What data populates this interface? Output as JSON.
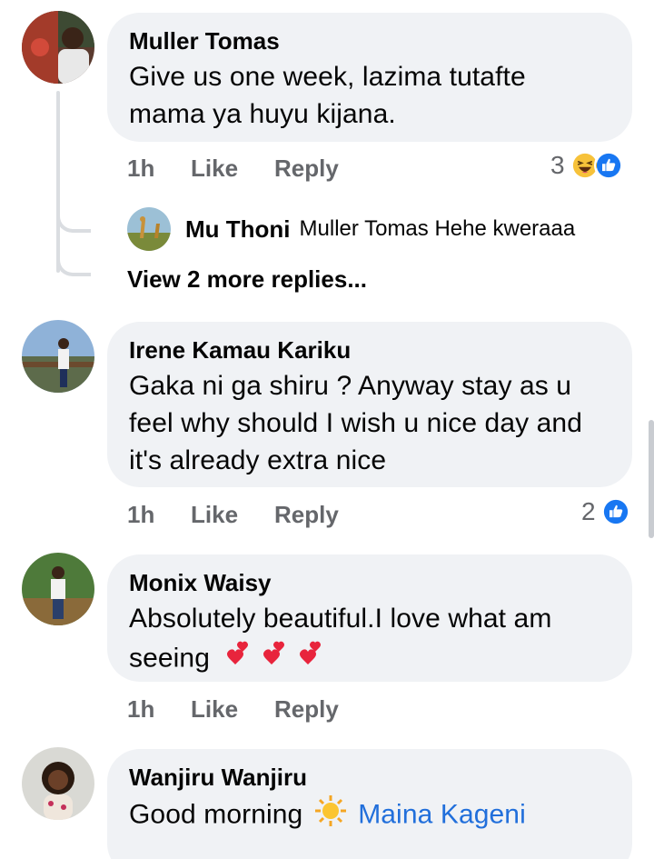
{
  "comments": [
    {
      "author": "Muller Tomas",
      "text_lines": [
        "Give us one week, lazima tutafte",
        "mama ya huyu kijana."
      ],
      "time": "1h",
      "like_label": "Like",
      "reply_label": "Reply",
      "reaction_count": "3",
      "reaction_icons": [
        "haha-icon",
        "like-icon"
      ],
      "reply": {
        "author": "Mu Thoni",
        "text": "Muller Tomas Hehe kweraaa"
      },
      "more_replies_label": "View 2 more replies..."
    },
    {
      "author": "Irene Kamau Kariku",
      "text_lines": [
        "Gaka ni ga shiru ?  Anyway stay as u",
        "feel why should I wish u nice day and",
        "it's already extra nice"
      ],
      "time": "1h",
      "like_label": "Like",
      "reply_label": "Reply",
      "reaction_count": "2",
      "reaction_icons": [
        "like-icon"
      ]
    },
    {
      "author": "Monix Waisy",
      "text_lines": [
        "Absolutely beautiful.I love what am",
        "seeing"
      ],
      "emoji_suffix": "two-hearts-icon x3",
      "time": "1h",
      "like_label": "Like",
      "reply_label": "Reply"
    },
    {
      "author": "Wanjiru Wanjiru",
      "text_prefix": "Good morning",
      "emoji": "sun-icon",
      "mention": "Maina Kageni"
    }
  ],
  "colors": {
    "bubble": "#f0f2f5",
    "meta_text": "#65676b",
    "mention": "#216fdb",
    "like_blue": "#1877f2"
  }
}
